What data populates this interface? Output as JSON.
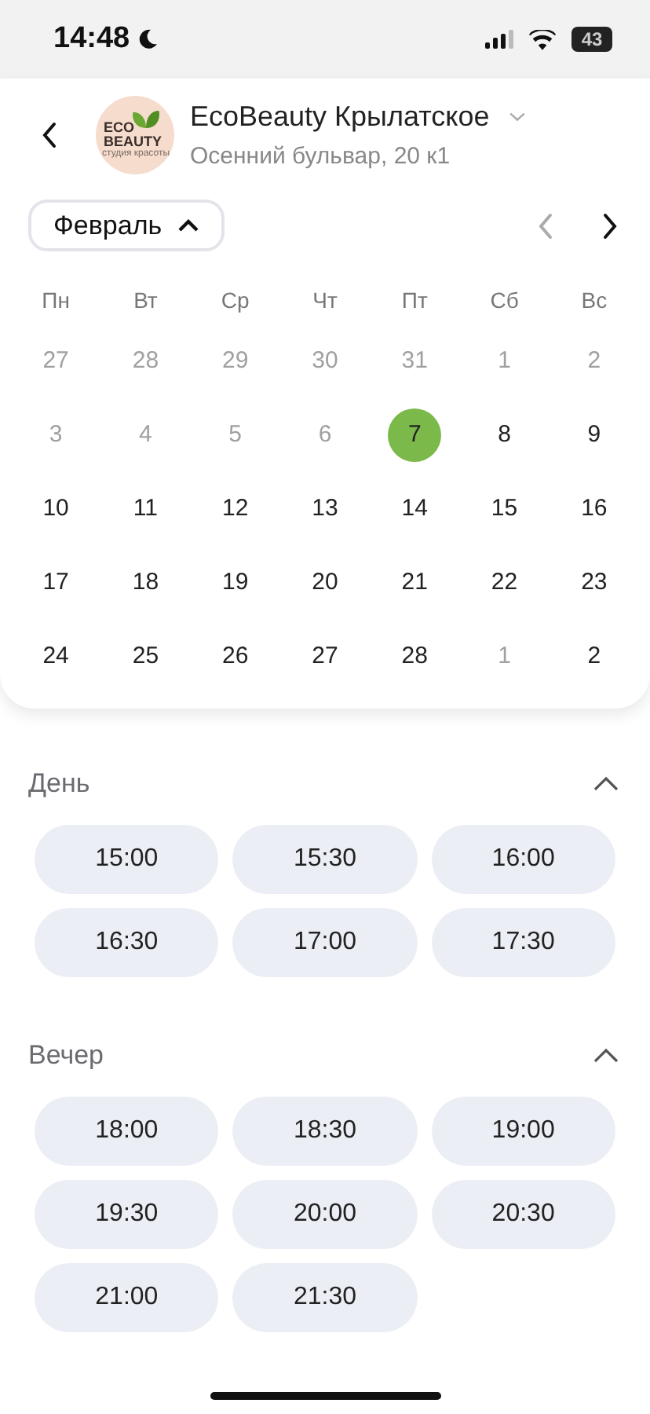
{
  "status_bar": {
    "time": "14:48",
    "battery": "43"
  },
  "header": {
    "logo_lines": [
      "ECO",
      "BEAUTY"
    ],
    "logo_tagline": "студия красоты",
    "title": "EcoBeauty Крылатское",
    "address": "Осенний бульвар, 20 к1"
  },
  "month_picker": {
    "label": "Февраль",
    "expanded": true
  },
  "weekdays": [
    "Пн",
    "Вт",
    "Ср",
    "Чт",
    "Пт",
    "Сб",
    "Вс"
  ],
  "days": [
    {
      "label": "27",
      "muted": true,
      "selected": false
    },
    {
      "label": "28",
      "muted": true,
      "selected": false
    },
    {
      "label": "29",
      "muted": true,
      "selected": false
    },
    {
      "label": "30",
      "muted": true,
      "selected": false
    },
    {
      "label": "31",
      "muted": true,
      "selected": false
    },
    {
      "label": "1",
      "muted": true,
      "selected": false
    },
    {
      "label": "2",
      "muted": true,
      "selected": false
    },
    {
      "label": "3",
      "muted": true,
      "selected": false
    },
    {
      "label": "4",
      "muted": true,
      "selected": false
    },
    {
      "label": "5",
      "muted": true,
      "selected": false
    },
    {
      "label": "6",
      "muted": true,
      "selected": false
    },
    {
      "label": "7",
      "muted": false,
      "selected": true
    },
    {
      "label": "8",
      "muted": false,
      "selected": false
    },
    {
      "label": "9",
      "muted": false,
      "selected": false
    },
    {
      "label": "10",
      "muted": false,
      "selected": false
    },
    {
      "label": "11",
      "muted": false,
      "selected": false
    },
    {
      "label": "12",
      "muted": false,
      "selected": false
    },
    {
      "label": "13",
      "muted": false,
      "selected": false
    },
    {
      "label": "14",
      "muted": false,
      "selected": false
    },
    {
      "label": "15",
      "muted": false,
      "selected": false
    },
    {
      "label": "16",
      "muted": false,
      "selected": false
    },
    {
      "label": "17",
      "muted": false,
      "selected": false
    },
    {
      "label": "18",
      "muted": false,
      "selected": false
    },
    {
      "label": "19",
      "muted": false,
      "selected": false
    },
    {
      "label": "20",
      "muted": false,
      "selected": false
    },
    {
      "label": "21",
      "muted": false,
      "selected": false
    },
    {
      "label": "22",
      "muted": false,
      "selected": false
    },
    {
      "label": "23",
      "muted": false,
      "selected": false
    },
    {
      "label": "24",
      "muted": false,
      "selected": false
    },
    {
      "label": "25",
      "muted": false,
      "selected": false
    },
    {
      "label": "26",
      "muted": false,
      "selected": false
    },
    {
      "label": "27",
      "muted": false,
      "selected": false
    },
    {
      "label": "28",
      "muted": false,
      "selected": false
    },
    {
      "label": "1",
      "muted": true,
      "selected": false
    },
    {
      "label": "2",
      "muted": false,
      "selected": false
    }
  ],
  "sections": [
    {
      "title": "День",
      "expanded": true,
      "slots": [
        "15:00",
        "15:30",
        "16:00",
        "16:30",
        "17:00",
        "17:30"
      ]
    },
    {
      "title": "Вечер",
      "expanded": true,
      "slots": [
        "18:00",
        "18:30",
        "19:00",
        "19:30",
        "20:00",
        "20:30",
        "21:00",
        "21:30"
      ]
    }
  ]
}
